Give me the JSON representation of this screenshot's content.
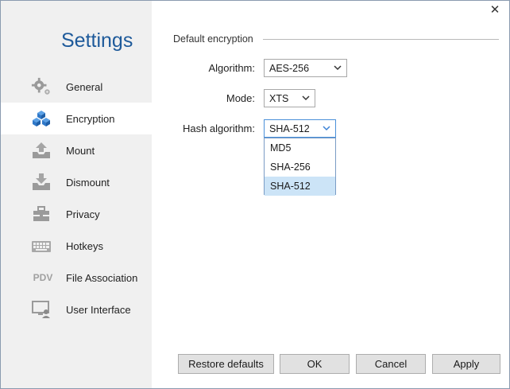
{
  "sidebar": {
    "title": "Settings",
    "items": [
      {
        "label": "General",
        "icon": "gears-icon"
      },
      {
        "label": "Encryption",
        "icon": "cubes-icon"
      },
      {
        "label": "Mount",
        "icon": "mount-icon"
      },
      {
        "label": "Dismount",
        "icon": "dismount-icon"
      },
      {
        "label": "Privacy",
        "icon": "toolbox-icon"
      },
      {
        "label": "Hotkeys",
        "icon": "keyboard-icon"
      },
      {
        "label": "File Association",
        "icon": "pdv-icon",
        "icon_text": "PDV"
      },
      {
        "label": "User Interface",
        "icon": "monitor-user-icon"
      }
    ],
    "active_index": 1
  },
  "window": {
    "close_glyph": "✕"
  },
  "encryption": {
    "group_title": "Default encryption",
    "algorithm": {
      "label": "Algorithm:",
      "value": "AES-256"
    },
    "mode": {
      "label": "Mode:",
      "value": "XTS"
    },
    "hash": {
      "label": "Hash algorithm:",
      "value": "SHA-512",
      "options": [
        "MD5",
        "SHA-256",
        "SHA-512"
      ],
      "highlighted_index": 2
    }
  },
  "buttons": {
    "restore": "Restore defaults",
    "ok": "OK",
    "cancel": "Cancel",
    "apply": "Apply"
  },
  "colors": {
    "accent": "#1e5a9a",
    "icon_blue": "#3b82d6",
    "sidebar_bg": "#f0f0f0",
    "dropdown_highlight": "#cce4f7"
  }
}
